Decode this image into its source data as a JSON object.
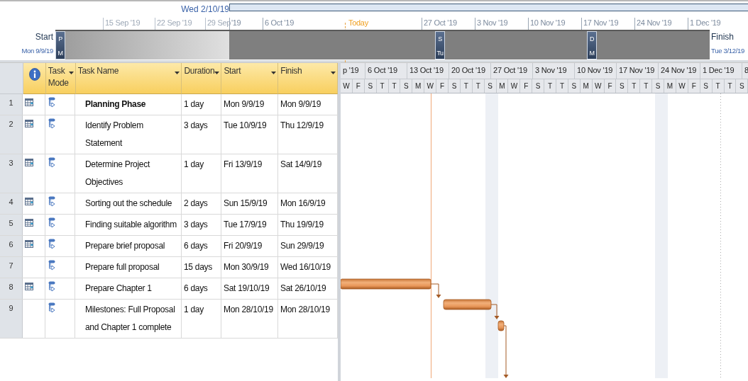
{
  "timeline": {
    "view_start": "Wed 2/10/19",
    "ticks": [
      {
        "label": "15 Sep '19",
        "kind": "faded"
      },
      {
        "label": "22 Sep '19",
        "kind": "faded"
      },
      {
        "label": "29 Sep",
        "kind": "faded"
      },
      {
        "label": "'19",
        "kind": "date"
      },
      {
        "label": "6 Oct '19",
        "kind": "date"
      },
      {
        "label": "Today",
        "kind": "today"
      },
      {
        "label": "27 Oct '19",
        "kind": "date"
      },
      {
        "label": "3 Nov '19",
        "kind": "date"
      },
      {
        "label": "10 Nov '19",
        "kind": "date"
      },
      {
        "label": "17 Nov '19",
        "kind": "date"
      },
      {
        "label": "24 Nov '19",
        "kind": "date"
      },
      {
        "label": "1 Dec '19",
        "kind": "date"
      }
    ],
    "start": {
      "label": "Start",
      "date": "Mon 9/9/19"
    },
    "finish": {
      "label": "Finish",
      "date": "Tue 3/12/19"
    },
    "tasks": [
      {
        "letters": [
          "P",
          "M"
        ]
      },
      {
        "letters": [
          "S",
          "Tu"
        ]
      },
      {
        "letters": [
          "D",
          "M"
        ]
      }
    ]
  },
  "table": {
    "columns": [
      {
        "kind": "info"
      },
      {
        "kind": "text",
        "label": "Task Mode"
      },
      {
        "kind": "text",
        "label": "Task Name"
      },
      {
        "kind": "text",
        "label": "Duration"
      },
      {
        "kind": "text",
        "label": "Start"
      },
      {
        "kind": "text",
        "label": "Finish"
      }
    ],
    "rows": [
      {
        "id": "1",
        "calendar": true,
        "bold": true,
        "name": "Planning Phase",
        "duration": "1 day",
        "start": "Mon 9/9/19",
        "finish": "Mon 9/9/19"
      },
      {
        "id": "2",
        "calendar": true,
        "bold": false,
        "name": "Identify Problem Statement",
        "duration": "3 days",
        "start": "Tue 10/9/19",
        "finish": "Thu 12/9/19"
      },
      {
        "id": "3",
        "calendar": true,
        "bold": false,
        "name": "Determine Project Objectives",
        "duration": "1 day",
        "start": "Fri 13/9/19",
        "finish": "Sat 14/9/19"
      },
      {
        "id": "4",
        "calendar": true,
        "bold": false,
        "name": "Sorting out the schedule",
        "duration": "2 days",
        "start": "Sun 15/9/19",
        "finish": "Mon 16/9/19"
      },
      {
        "id": "5",
        "calendar": true,
        "bold": false,
        "name": "Finding suitable algorithm",
        "duration": "3 days",
        "start": "Tue 17/9/19",
        "finish": "Thu 19/9/19"
      },
      {
        "id": "6",
        "calendar": true,
        "bold": false,
        "name": "Prepare brief proposal",
        "duration": "6 days",
        "start": "Fri 20/9/19",
        "finish": "Sun 29/9/19"
      },
      {
        "id": "7",
        "calendar": false,
        "bold": false,
        "name": "Prepare full proposal",
        "duration": "15 days",
        "start": "Mon 30/9/19",
        "finish": "Wed 16/10/19"
      },
      {
        "id": "8",
        "calendar": true,
        "bold": false,
        "name": "Prepare Chapter 1",
        "duration": "6 days",
        "start": "Sat 19/10/19",
        "finish": "Sat 26/10/19"
      },
      {
        "id": "9",
        "calendar": false,
        "bold": false,
        "name": "Milestones: Full Proposal and Chapter 1 complete",
        "duration": "1 day",
        "start": "Mon 28/10/19",
        "finish": "Mon 28/10/19"
      }
    ]
  },
  "gantt": {
    "weeks": [
      "p '19",
      "6 Oct '19",
      "13 Oct '19",
      "20 Oct '19",
      "27 Oct '19",
      "3 Nov '19",
      "10 Nov '19",
      "17 Nov '19",
      "24 Nov '19",
      "1 Dec '19",
      "8"
    ],
    "days": [
      "W",
      "F",
      "S",
      "T",
      "T",
      "S",
      "M",
      "W",
      "F",
      "S",
      "T",
      "T",
      "S",
      "M",
      "W",
      "F",
      "S",
      "T",
      "T",
      "S",
      "M",
      "W",
      "F",
      "S",
      "T",
      "T",
      "S",
      "M",
      "W",
      "F",
      "S",
      "T",
      "T",
      "S"
    ]
  }
}
